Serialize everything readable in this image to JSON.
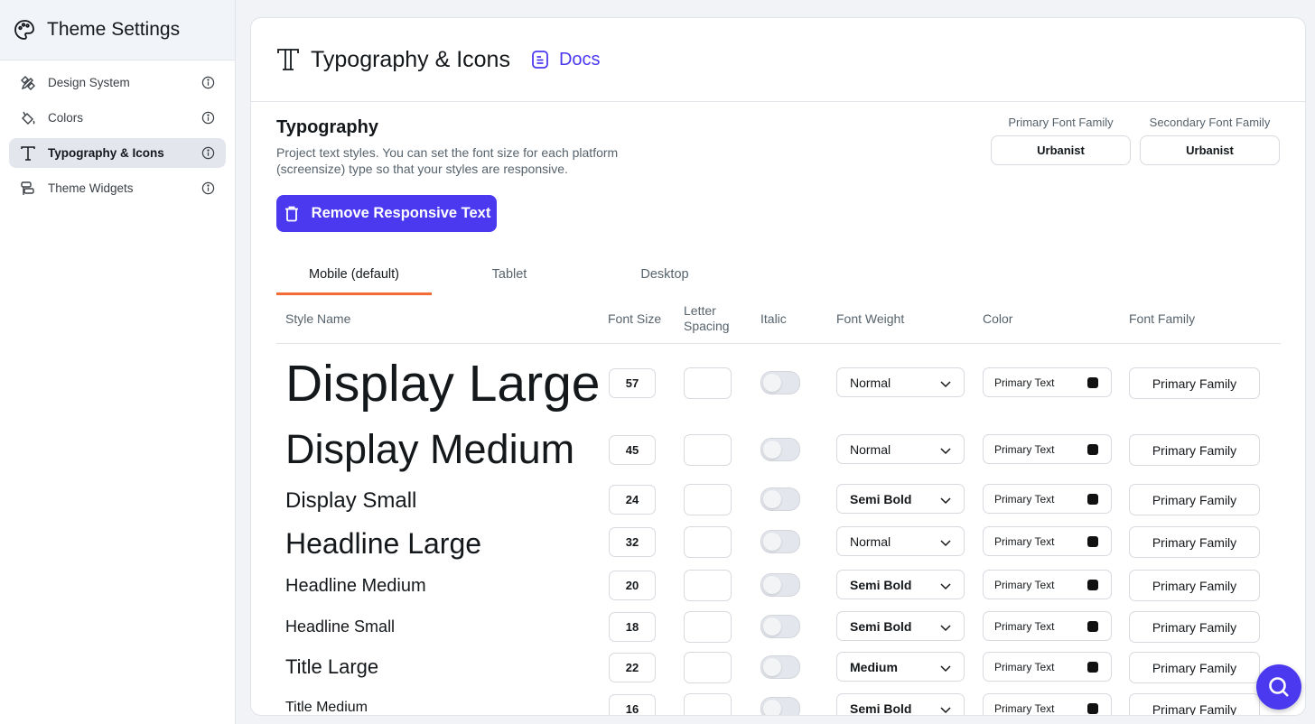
{
  "sidebar": {
    "title": "Theme Settings",
    "items": [
      {
        "label": "Design System",
        "icon": "design-tools-icon",
        "active": false
      },
      {
        "label": "Colors",
        "icon": "paint-bucket-icon",
        "active": false
      },
      {
        "label": "Typography & Icons",
        "icon": "typography-icon",
        "active": true
      },
      {
        "label": "Theme Widgets",
        "icon": "widgets-icon",
        "active": false
      }
    ]
  },
  "header": {
    "title": "Typography & Icons",
    "docs_label": "Docs"
  },
  "typography": {
    "title": "Typography",
    "description": "Project text styles. You can set the font size for each platform (screensize) type so that your styles are responsive.",
    "primary_font_label": "Primary Font Family",
    "primary_font_value": "Urbanist",
    "secondary_font_label": "Secondary Font Family",
    "secondary_font_value": "Urbanist",
    "remove_button_label": "Remove Responsive Text"
  },
  "tabs": [
    "Mobile (default)",
    "Tablet",
    "Desktop"
  ],
  "active_tab": 0,
  "columns": {
    "style_name": "Style Name",
    "font_size": "Font Size",
    "letter_spacing": "Letter Spacing",
    "italic": "Italic",
    "font_weight": "Font Weight",
    "color": "Color",
    "font_family": "Font Family"
  },
  "rows": [
    {
      "name": "Display Large",
      "size": "57",
      "weight": "Normal",
      "color": "Primary Text",
      "family": "Primary Family"
    },
    {
      "name": "Display Medium",
      "size": "45",
      "weight": "Normal",
      "color": "Primary Text",
      "family": "Primary Family"
    },
    {
      "name": "Display Small",
      "size": "24",
      "weight": "Semi Bold",
      "color": "Primary Text",
      "family": "Primary Family"
    },
    {
      "name": "Headline Large",
      "size": "32",
      "weight": "Normal",
      "color": "Primary Text",
      "family": "Primary Family"
    },
    {
      "name": "Headline Medium",
      "size": "20",
      "weight": "Semi Bold",
      "color": "Primary Text",
      "family": "Primary Family"
    },
    {
      "name": "Headline Small",
      "size": "18",
      "weight": "Semi Bold",
      "color": "Primary Text",
      "family": "Primary Family"
    },
    {
      "name": "Title Large",
      "size": "22",
      "weight": "Medium",
      "color": "Primary Text",
      "family": "Primary Family"
    },
    {
      "name": "Title Medium",
      "size": "16",
      "weight": "Semi Bold",
      "color": "Primary Text",
      "family": "Primary Family"
    }
  ],
  "colors": {
    "accent": "#4b39ef",
    "tab_underline": "#f46b36",
    "primary_text_swatch": "#111111"
  },
  "fab_icon": "search-icon"
}
